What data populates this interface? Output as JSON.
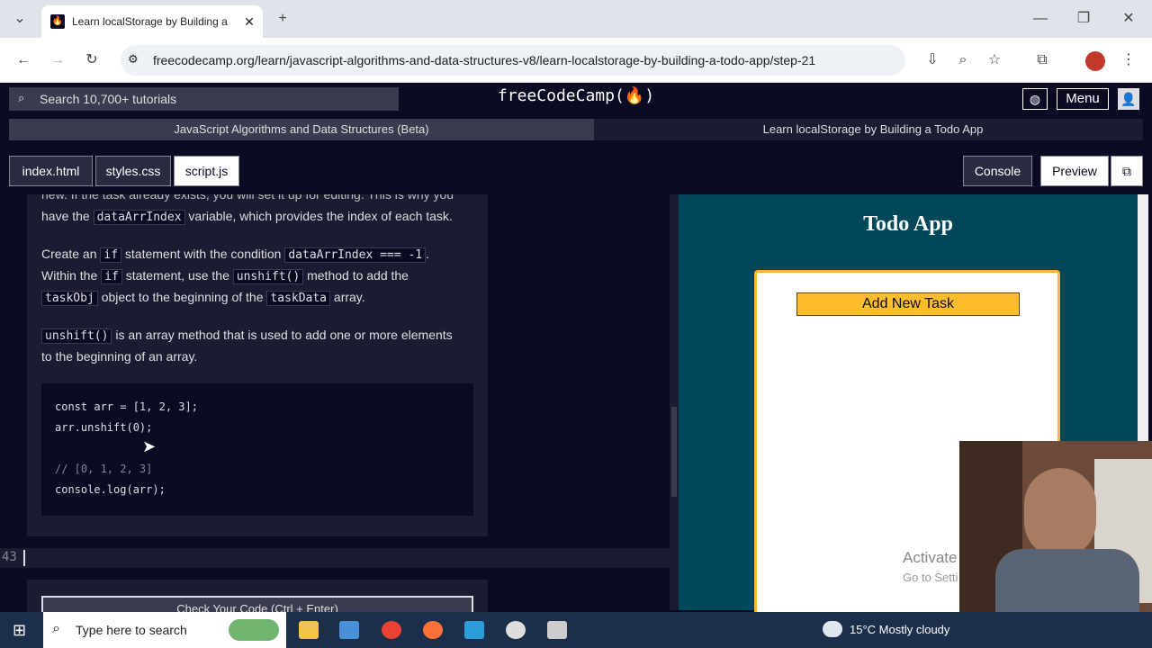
{
  "browser": {
    "tab_title": "Learn localStorage by Building a",
    "url": "freecodecamp.org/learn/javascript-algorithms-and-data-structures-v8/learn-localstorage-by-building-a-todo-app/step-21"
  },
  "fcc": {
    "search_placeholder": "Search 10,700+ tutorials",
    "logo": "freeCodeCamp(🔥)",
    "menu_label": "Menu",
    "breadcrumb_course": "JavaScript Algorithms and Data Structures (Beta)",
    "breadcrumb_project": "Learn localStorage by Building a Todo App",
    "file_tabs": [
      "index.html",
      "styles.css",
      "script.js"
    ],
    "console_label": "Console",
    "preview_label": "Preview"
  },
  "instructions": {
    "p1a": "new. If the task already exists, you will set it up for editing. This is why you",
    "p1b_pre": "have the",
    "p1b_code": "dataArrIndex",
    "p1b_post": "variable, which provides the index of each task.",
    "p2_pre": "Create an",
    "p2_code1": "if",
    "p2_mid1": "statement with the condition",
    "p2_code2": "dataArrIndex === -1",
    "p2_end": ".",
    "p3_pre": "Within the",
    "p3_code1": "if",
    "p3_mid": "statement, use the",
    "p3_code2": "unshift()",
    "p3_post": "method to add the",
    "p4_code1": "taskObj",
    "p4_mid": "object to the beginning of the",
    "p4_code2": "taskData",
    "p4_post": "array.",
    "p5_code": "unshift()",
    "p5_post": "is an array method that is used to add one or more elements",
    "p6": "to the beginning of an array.",
    "code_lines": [
      "const arr = [1, 2, 3];",
      "arr.unshift(0);",
      "",
      "// [0, 1, 2, 3]",
      "console.log(arr);"
    ],
    "submit_label": "Check Your Code (Ctrl + Enter)"
  },
  "editor": {
    "line_number": "43"
  },
  "preview": {
    "title": "Todo App",
    "add_button": "Add New Task",
    "watermark1": "Activate",
    "watermark2": "Go to Setti"
  },
  "taskbar": {
    "search_placeholder": "Type here to search",
    "weather": "15°C  Mostly cloudy"
  },
  "colors": {
    "fcc_dark": "#0a0a23",
    "fcc_panel": "#1b1b32",
    "accent_yellow": "#febe2b",
    "preview_bg": "#00475a"
  }
}
